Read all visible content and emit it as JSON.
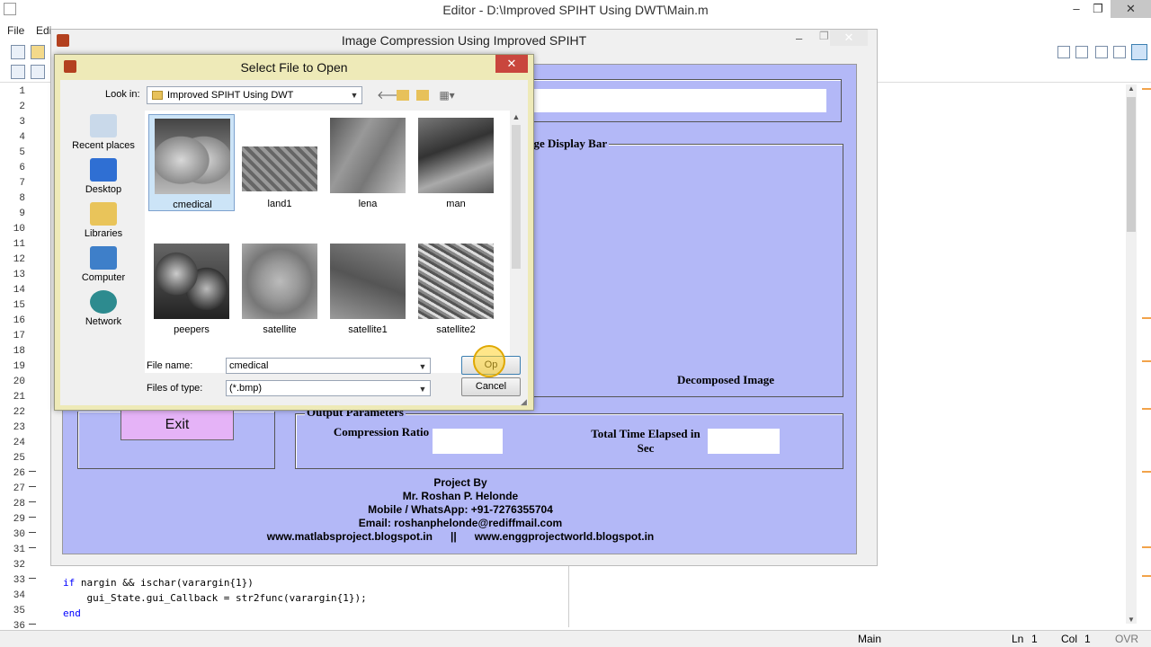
{
  "editor": {
    "title": "Editor - D:\\Improved SPIHT Using DWT\\Main.m",
    "window_controls": [
      "–",
      "❐",
      "✕"
    ],
    "menus": [
      "File",
      "Edi"
    ],
    "line_numbers": [
      "1",
      "2",
      "3",
      "4",
      "5",
      "6",
      "7",
      "8",
      "9",
      "10",
      "11",
      "12",
      "13",
      "14",
      "15",
      "16",
      "17",
      "18",
      "19",
      "20",
      "21",
      "22",
      "23",
      "24",
      "25",
      "26",
      "27",
      "28",
      "29",
      "30",
      "31",
      "32",
      "33",
      "34",
      "35",
      "36"
    ],
    "code_lines": {
      "line33_kw": "if",
      "line33_rest": " nargin && ischar(varargin{1})",
      "line34": "    gui_State.gui_Callback = str2func(varargin{1});",
      "line35_kw": "end"
    },
    "status": {
      "function": "Main",
      "ln_label": "Ln",
      "ln": "1",
      "col_label": "Col",
      "col": "1",
      "mode": "OVR"
    }
  },
  "gui": {
    "title": "Image Compression Using Improved SPIHT",
    "close_glyph": "✕",
    "display_bar_label": "age Display Bar",
    "decomposed_label": "Decomposed Image",
    "exit_label": "Exit",
    "output_params_label": "Output Parameters",
    "compression_ratio_label": "Compression Ratio",
    "time_elapsed_label": "Total Time Elapsed in Sec",
    "credits": {
      "project_by": "Project By",
      "name": "Mr. Roshan P. Helonde",
      "mobile": "Mobile / WhatsApp: +91-7276355704",
      "email": "Email: roshanphelonde@rediffmail.com",
      "websites": "www.matlabsproject.blogspot.in      ||      www.enggprojectworld.blogspot.in"
    }
  },
  "dialog": {
    "title": "Select File to Open",
    "close_glyph": "✕",
    "look_in_label": "Look in:",
    "look_in_value": "Improved SPIHT Using DWT",
    "places": [
      "Recent places",
      "Desktop",
      "Libraries",
      "Computer",
      "Network"
    ],
    "files": [
      "cmedical",
      "land1",
      "lena",
      "man",
      "peepers",
      "satellite",
      "satellite1",
      "satellite2"
    ],
    "selected_file": "cmedical",
    "file_name_label": "File name:",
    "file_name_value": "cmedical",
    "file_type_label": "Files of type:",
    "file_type_value": "(*.bmp)",
    "open_label": "Op",
    "cancel_label": "Cancel"
  },
  "colors": {
    "gui_panel": "#b3b8f7",
    "exit_button": "#e5b3f7",
    "dialog_frame": "#eeeab8",
    "selection": "#cce4f7"
  }
}
